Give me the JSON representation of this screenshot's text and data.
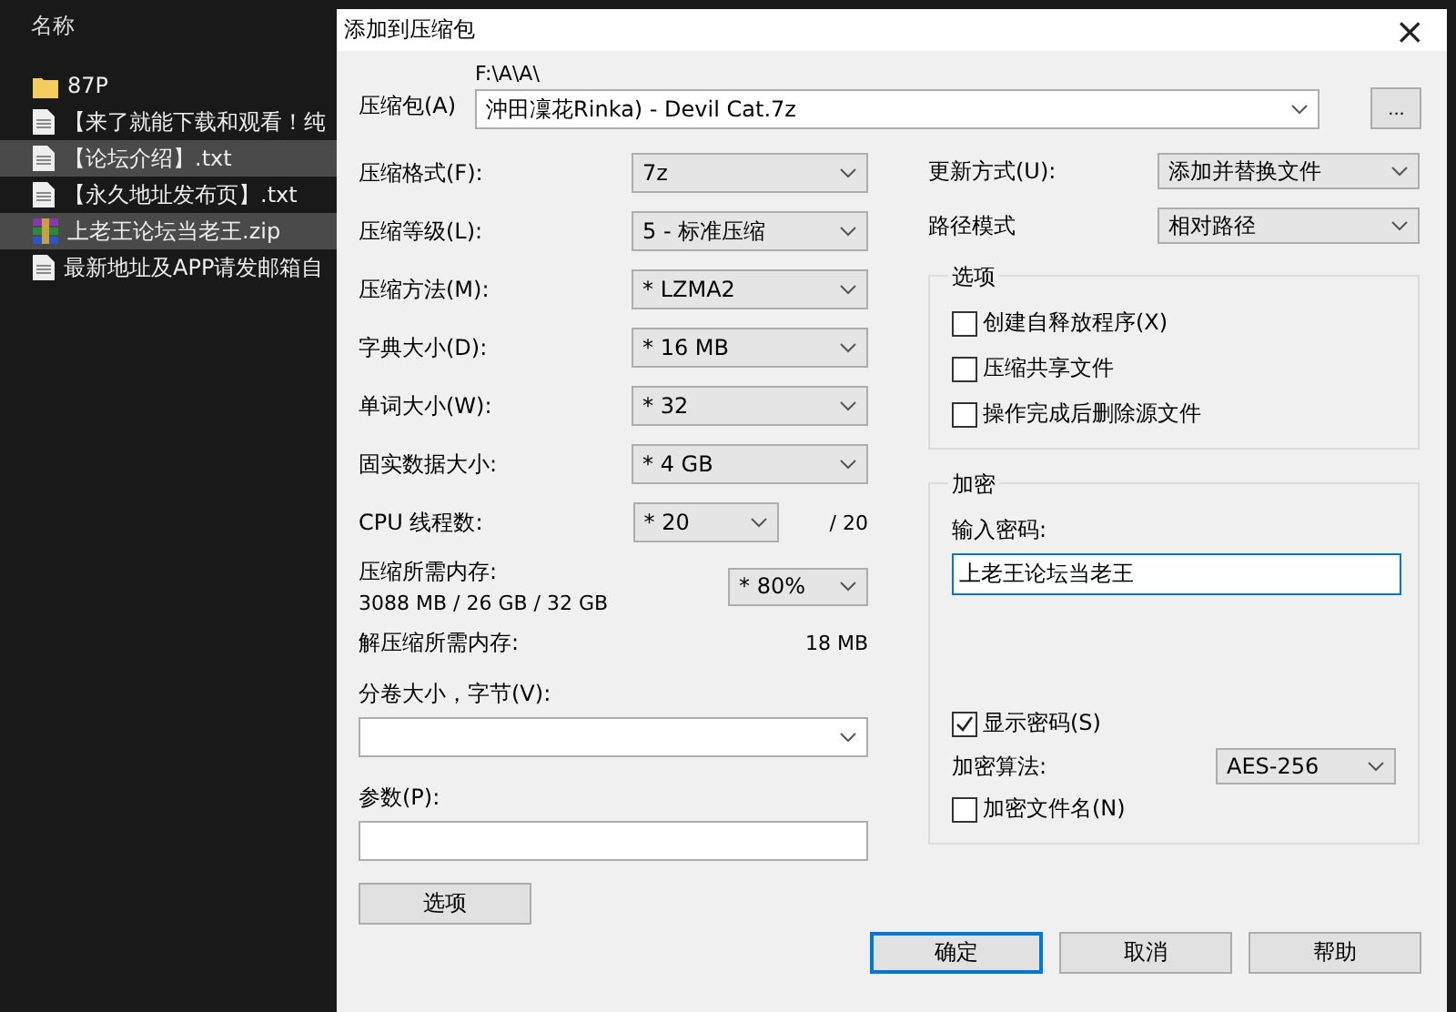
{
  "explorer": {
    "header": "名称",
    "items": [
      {
        "name": "87P",
        "kind": "folder",
        "selected": false
      },
      {
        "name": "【来了就能下载和观看！纯",
        "kind": "text",
        "selected": false
      },
      {
        "name": "【论坛介绍】.txt",
        "kind": "text",
        "selected": true
      },
      {
        "name": "【永久地址发布页】.txt",
        "kind": "text",
        "selected": false
      },
      {
        "name": "上老王论坛当老王.zip",
        "kind": "archive",
        "selected": true
      },
      {
        "name": "最新地址及APP请发邮箱自",
        "kind": "text",
        "selected": false
      }
    ]
  },
  "dialog": {
    "title": "添加到压缩包",
    "close": "×",
    "archive": {
      "label": "压缩包(A)",
      "path": "F:\\A\\A\\",
      "value": "沖田凜花Rinka) - Devil Cat.7z",
      "browse": "..."
    },
    "left_rows": [
      {
        "kind": "select",
        "label": "压缩格式(F):",
        "value": "7z"
      },
      {
        "kind": "select",
        "label": "压缩等级(L):",
        "value": "5 - 标准压缩"
      },
      {
        "kind": "select",
        "label": "压缩方法(M):",
        "value": "* LZMA2"
      },
      {
        "kind": "select",
        "label": "字典大小(D):",
        "value": "* 16 MB"
      },
      {
        "kind": "select",
        "label": "单词大小(W):",
        "value": "* 32"
      },
      {
        "kind": "select",
        "label": "固实数据大小:",
        "value": "* 4 GB"
      },
      {
        "kind": "threads",
        "label": "CPU 线程数:",
        "value": "* 20",
        "suffix": "/ 20"
      },
      {
        "kind": "memory",
        "label": "压缩所需内存:",
        "detail": "3088 MB / 26 GB / 32 GB",
        "value": "* 80%"
      },
      {
        "kind": "info",
        "label": "解压缩所需内存:",
        "value": "18 MB"
      }
    ],
    "volume": {
      "label": "分卷大小，字节(V):"
    },
    "params": {
      "label": "参数(P):"
    },
    "options_button": "选项",
    "update": {
      "label": "更新方式(U):",
      "value": "添加并替换文件"
    },
    "path_mode": {
      "label": "路径模式",
      "value": "相对路径"
    },
    "options_group": {
      "title": "选项",
      "checks": [
        {
          "label": "创建自释放程序(X)",
          "checked": false
        },
        {
          "label": "压缩共享文件",
          "checked": false
        },
        {
          "label": "操作完成后删除源文件",
          "checked": false
        }
      ]
    },
    "encryption": {
      "title": "加密",
      "password_label": "输入密码:",
      "password": "上老王论坛当老王",
      "show_password": {
        "label": "显示密码(S)",
        "checked": true
      },
      "method_label": "加密算法:",
      "method": "AES-256",
      "encrypt_names": {
        "label": "加密文件名(N)",
        "checked": false
      }
    },
    "buttons": [
      {
        "label": "确定",
        "default": true
      },
      {
        "label": "取消",
        "default": false
      },
      {
        "label": "帮助",
        "default": false
      }
    ]
  }
}
